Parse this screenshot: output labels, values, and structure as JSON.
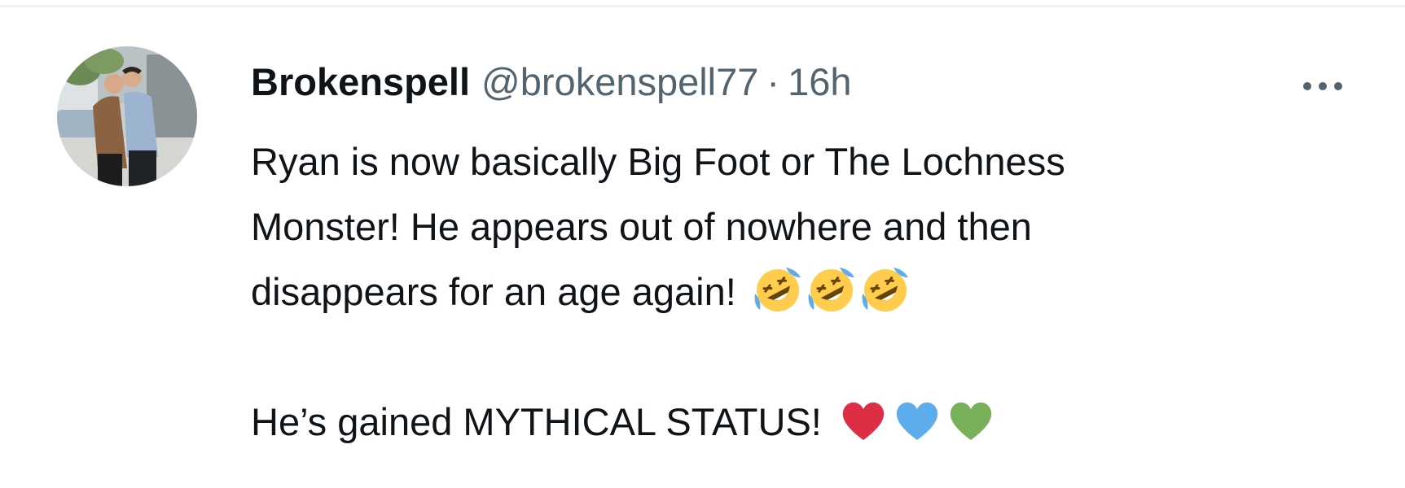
{
  "tweet": {
    "author": {
      "display_name": "Brokenspell",
      "handle": "@brokenspell77"
    },
    "separator": "·",
    "time": "16h",
    "more_icon": "more-horizontal-icon",
    "text": {
      "line_1": "Ryan is now basically Big Foot or The Lochness",
      "line_2": "Monster! He appears out of nowhere and then",
      "line_3": "disappears for an age again!",
      "line_3_emojis": [
        "rolling-on-floor-laughing-emoji",
        "rolling-on-floor-laughing-emoji",
        "rolling-on-floor-laughing-emoji"
      ],
      "line_5": "He’s gained MYTHICAL STATUS!",
      "line_5_emojis": [
        "red-heart-emoji",
        "blue-heart-emoji",
        "green-heart-emoji"
      ]
    }
  },
  "colors": {
    "name": "#0f1419",
    "secondary": "#536471",
    "divider": "#eff3f4",
    "red_heart": "#dd2e44",
    "blue_heart": "#5dadec",
    "green_heart": "#78b159",
    "emoji_face": "#ffcc4d",
    "emoji_tear": "#5dadec"
  }
}
